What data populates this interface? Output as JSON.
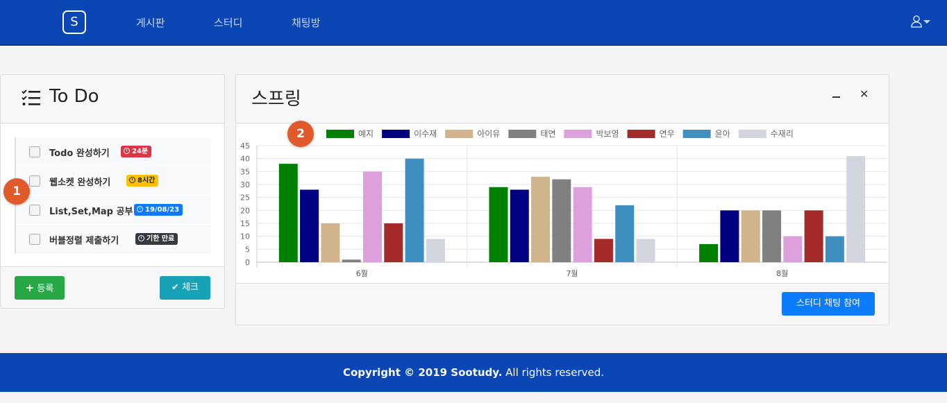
{
  "navbar": {
    "brand": "S",
    "links": [
      "게시판",
      "스터디",
      "채팅방"
    ],
    "user_icon": "user-icon"
  },
  "todo": {
    "title": "To Do",
    "items": [
      {
        "text": "Todo 완성하기",
        "badge": "24분",
        "badge_color": "#dc3545",
        "badge_text_color": "#ffffff"
      },
      {
        "text": "웹소켓 완성하기",
        "badge": "8시간",
        "badge_color": "#ffc107",
        "badge_text_color": "#212529"
      },
      {
        "text": "List,Set,Map 공부",
        "badge": "19/08/23",
        "badge_color": "#0b7bff",
        "badge_text_color": "#ffffff"
      },
      {
        "text": "버블정렬 제출하기",
        "badge": "기한 만료",
        "badge_color": "#343a40",
        "badge_text_color": "#ffffff"
      }
    ],
    "register_label": "등록",
    "check_label": "체크"
  },
  "chart_card": {
    "title": "스프링",
    "join_label": "스터디 채팅 참여"
  },
  "callouts": [
    "1",
    "2"
  ],
  "footer": {
    "bold": "Copyright © 2019 Sootudy.",
    "rest": " All rights reserved."
  },
  "chart_data": {
    "type": "bar",
    "categories": [
      "6월",
      "7월",
      "8월"
    ],
    "series": [
      {
        "name": "예지",
        "color": "#008000",
        "values": [
          38,
          29,
          7
        ]
      },
      {
        "name": "이수재",
        "color": "#000080",
        "values": [
          28,
          28,
          20
        ]
      },
      {
        "name": "아이유",
        "color": "#d2b48c",
        "values": [
          15,
          33,
          20
        ]
      },
      {
        "name": "태연",
        "color": "#808080",
        "values": [
          1,
          32,
          20
        ]
      },
      {
        "name": "박보영",
        "color": "#dda0dd",
        "values": [
          35,
          29,
          10
        ]
      },
      {
        "name": "연우",
        "color": "#a52a2a",
        "values": [
          15,
          9,
          20
        ]
      },
      {
        "name": "윤아",
        "color": "#3f8fc0",
        "values": [
          40,
          22,
          10
        ]
      },
      {
        "name": "수재리",
        "color": "#d3d6de",
        "values": [
          9,
          9,
          41
        ]
      }
    ],
    "ylim": [
      0,
      45
    ],
    "yticks": [
      0,
      5,
      10,
      15,
      20,
      25,
      30,
      35,
      40,
      45
    ],
    "legend": "top",
    "grid": true
  }
}
